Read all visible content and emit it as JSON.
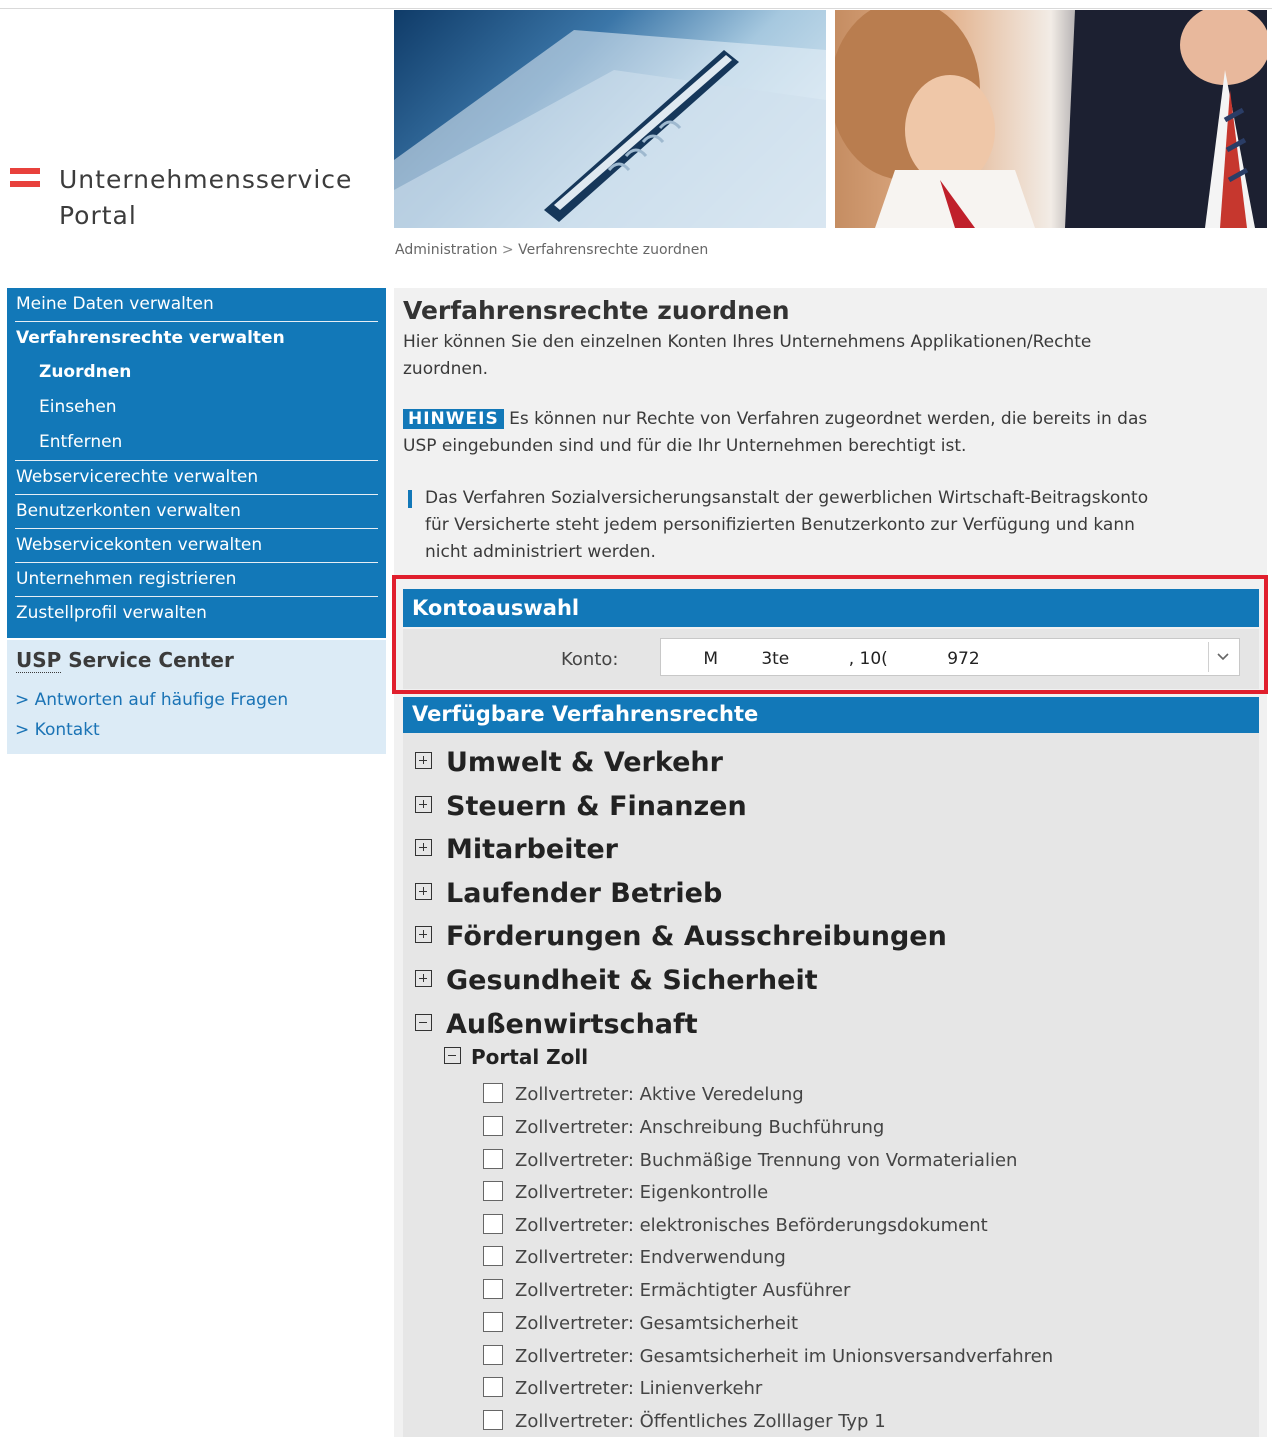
{
  "logo": {
    "line1": "Unternehmensservice",
    "line2": "Portal"
  },
  "breadcrumb": {
    "part1": "Administration",
    "sep": ">",
    "part2": "Verfahrensrechte zuordnen"
  },
  "sidebar": {
    "meine_daten": "Meine Daten verwalten",
    "verfahrensrechte": "Verfahrensrechte verwalten",
    "zuordnen": "Zuordnen",
    "einsehen": "Einsehen",
    "entfernen": "Entfernen",
    "webservicerechte": "Webservicerechte verwalten",
    "benutzerkonten": "Benutzerkonten verwalten",
    "webservicekonten": "Webservicekonten verwalten",
    "unternehmen": "Unternehmen registrieren",
    "zustellprofil": "Zustellprofil verwalten"
  },
  "service_center": {
    "usp": "USP",
    "title_rest": "Service Center",
    "faq": "> Antworten auf häufige Fragen",
    "kontakt": "> Kontakt"
  },
  "main": {
    "title": "Verfahrensrechte zuordnen",
    "intro_line1": "Hier können Sie den einzelnen Konten Ihres Unternehmens Applikationen/Rechte",
    "intro_line2": "zuordnen.",
    "hinweis_label": "HINWEIS",
    "hinweis_line1": "Es können nur Rechte von Verfahren zugeordnet werden, die bereits in das",
    "hinweis_line2": "USP eingebunden sind und für die Ihr Unternehmen berechtigt ist.",
    "note_line1": "Das Verfahren Sozialversicherungsanstalt der gewerblichen Wirtschaft-Beitragskonto",
    "note_line2": "für Versicherte steht jedem personifizierten Benutzerkonto zur Verfügung und kann",
    "note_line3": "nicht administriert werden."
  },
  "kontoauswahl": {
    "header": "Kontoauswahl",
    "label": "Konto:",
    "value": "      M        3te           , 10(           972"
  },
  "verfahrensrechte": {
    "header": "Verfügbare Verfahrensrechte",
    "categories": [
      "Umwelt & Verkehr",
      "Steuern & Finanzen",
      "Mitarbeiter",
      "Laufender Betrieb",
      "Förderungen & Ausschreibungen",
      "Gesundheit & Sicherheit",
      "Außenwirtschaft"
    ],
    "subcategory": "Portal Zoll",
    "items": [
      "Zollvertreter: Aktive Veredelung",
      "Zollvertreter: Anschreibung Buchführung",
      "Zollvertreter: Buchmäßige Trennung von Vormaterialien",
      "Zollvertreter: Eigenkontrolle",
      "Zollvertreter: elektronisches Beförderungsdokument",
      "Zollvertreter: Endverwendung",
      "Zollvertreter: Ermächtigter Ausführer",
      "Zollvertreter: Gesamtsicherheit",
      "Zollvertreter: Gesamtsicherheit im Unionsversandverfahren",
      "Zollvertreter: Linienverkehr",
      "Zollvertreter: Öffentliches Zolllager Typ 1"
    ]
  },
  "colors": {
    "brand_blue": "#1278b8",
    "highlight_red": "#e01f2d",
    "logo_red": "#e8413c",
    "sidebar_service_bg": "#dcebf6"
  },
  "icons": [
    "austria-flag-logo",
    "plus-box-icon",
    "minus-box-icon",
    "chevron-down-icon",
    "checkbox"
  ]
}
